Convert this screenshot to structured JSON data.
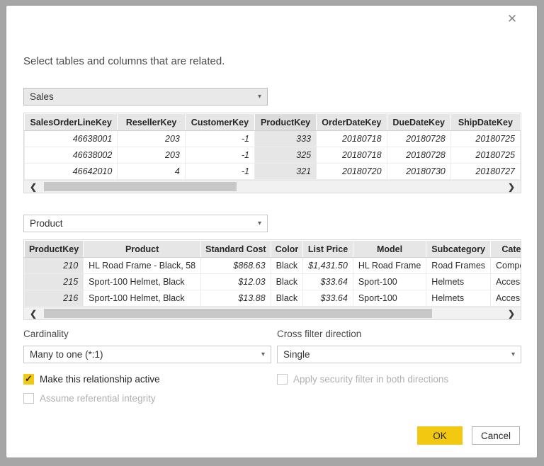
{
  "dialog": {
    "instruction": "Select tables and columns that are related.",
    "close_icon": "✕"
  },
  "from_table": {
    "dropdown_value": "Sales",
    "selected_column": "ProductKey",
    "headers": [
      "SalesOrderLineKey",
      "ResellerKey",
      "CustomerKey",
      "ProductKey",
      "OrderDateKey",
      "DueDateKey",
      "ShipDateKey"
    ],
    "rows": [
      [
        "46638001",
        "203",
        "-1",
        "333",
        "20180718",
        "20180728",
        "20180725"
      ],
      [
        "46638002",
        "203",
        "-1",
        "325",
        "20180718",
        "20180728",
        "20180725"
      ],
      [
        "46642010",
        "4",
        "-1",
        "321",
        "20180720",
        "20180730",
        "20180727"
      ]
    ]
  },
  "to_table": {
    "dropdown_value": "Product",
    "selected_column": "ProductKey",
    "headers": [
      "ProductKey",
      "Product",
      "Standard Cost",
      "Color",
      "List Price",
      "Model",
      "Subcategory",
      "Category"
    ],
    "rows": [
      [
        "210",
        "HL Road Frame - Black, 58",
        "$868.63",
        "Black",
        "$1,431.50",
        "HL Road Frame",
        "Road Frames",
        "Components"
      ],
      [
        "215",
        "Sport-100 Helmet, Black",
        "$12.03",
        "Black",
        "$33.64",
        "Sport-100",
        "Helmets",
        "Accessories"
      ],
      [
        "216",
        "Sport-100 Helmet, Black",
        "$13.88",
        "Black",
        "$33.64",
        "Sport-100",
        "Helmets",
        "Accessories"
      ]
    ]
  },
  "options": {
    "cardinality_label": "Cardinality",
    "cardinality_value": "Many to one (*:1)",
    "cross_filter_label": "Cross filter direction",
    "cross_filter_value": "Single",
    "make_active": {
      "label": "Make this relationship active",
      "checked": true,
      "enabled": true
    },
    "referential_integrity": {
      "label": "Assume referential integrity",
      "checked": false,
      "enabled": false
    },
    "security_filter": {
      "label": "Apply security filter in both directions",
      "checked": false,
      "enabled": false
    }
  },
  "buttons": {
    "ok_label": "OK",
    "cancel_label": "Cancel"
  },
  "colors": {
    "accent_yellow": "#f2c811",
    "header_bg": "#e6e6e6",
    "frame_gray": "#a6a6a6",
    "selected_column_bg": "#e6e6e6"
  }
}
